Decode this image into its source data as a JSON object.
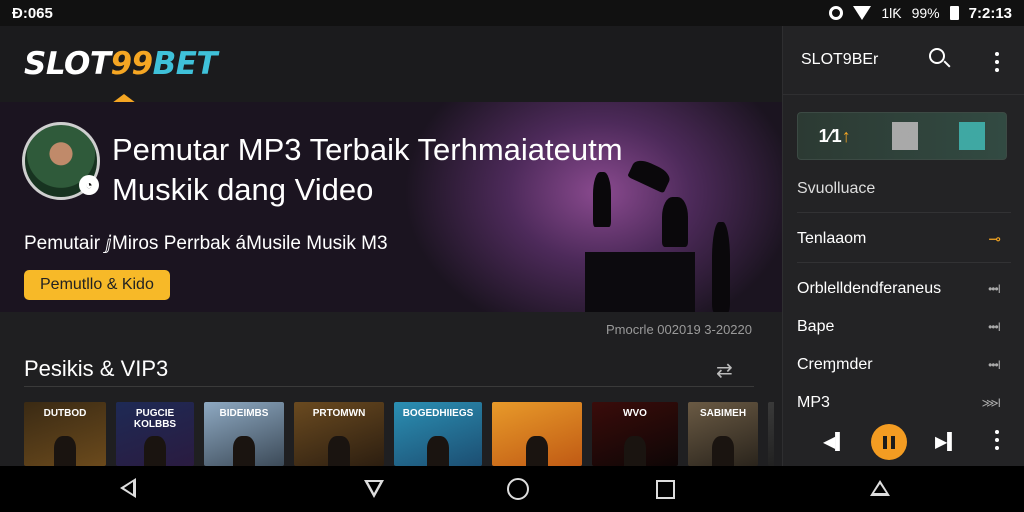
{
  "status_bar": {
    "left_time": "Ɖ:065",
    "battery_text": "99%",
    "network_text": "1lƘ",
    "clock": "7:2:13"
  },
  "app": {
    "logo": {
      "part1": "SLOT",
      "part2": "99",
      "part3": "BET"
    },
    "hero": {
      "title": "Pemutar MP3 Terbaik Terhmaiateutm Muskik dang Video",
      "subtitle": "Pemutair ⅉMiros Perrbak áMusile Musik M3",
      "button_label": "Pemutllo & Kido"
    },
    "date_line": "Pmocrle 002019 3-20220",
    "section_title": "Pesikis & VIP3",
    "thumbnails": [
      {
        "label": "DUTBOD",
        "colors": [
          "#3a2a14",
          "#6b4a1c"
        ]
      },
      {
        "label": "PUGCIE KOLBBS",
        "colors": [
          "#1e2a55",
          "#2a1b40"
        ]
      },
      {
        "label": "BIDEIMBS",
        "colors": [
          "#8ea9c2",
          "#3c4a58"
        ]
      },
      {
        "label": "PRTOMWN",
        "colors": [
          "#6a4a20",
          "#2c1e10"
        ]
      },
      {
        "label": "BOGEDHIIEGS",
        "colors": [
          "#2b8fb3",
          "#1c4e72"
        ]
      },
      {
        "label": "",
        "colors": [
          "#e89a2a",
          "#c05a14"
        ]
      },
      {
        "label": "WVO",
        "colors": [
          "#3a0c0a",
          "#0e0606"
        ]
      },
      {
        "label": "SABIMEH",
        "colors": [
          "#6a5a44",
          "#2a241c"
        ]
      },
      {
        "label": "",
        "colors": [
          "#3a3a3a",
          "#1a1a1a"
        ]
      }
    ]
  },
  "panel": {
    "title": "SLOT9BEr",
    "card": {
      "rank_text": "1⁄1",
      "arrow": "↑"
    },
    "category_label": "Svuolluace",
    "items": [
      {
        "label": "Tenlaaom",
        "icon": "⊸"
      },
      {
        "label": "Orblelldendferaneus",
        "icon": "•••I"
      },
      {
        "label": "Bape",
        "icon": "•••I"
      },
      {
        "label": "Creɱmder",
        "icon": "•••I"
      },
      {
        "label": "MP3",
        "icon": "⋙I"
      }
    ]
  },
  "colors": {
    "accent": "#f5a623",
    "logo_blue": "#3fc1d9",
    "button": "#f7b928",
    "play": "#f39c22"
  }
}
